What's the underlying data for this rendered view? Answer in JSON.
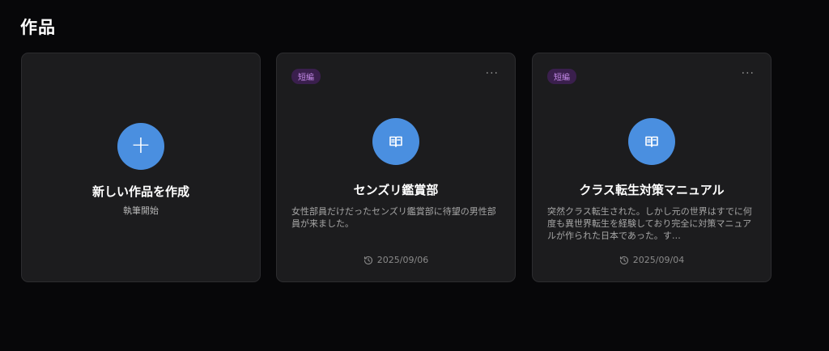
{
  "page": {
    "title": "作品"
  },
  "new_card": {
    "title": "新しい作品を作成",
    "subtitle": "執筆開始",
    "icon": "plus-icon"
  },
  "works": [
    {
      "badge": "短編",
      "title": "センズリ鑑賞部",
      "description": "女性部員だけだったセンズリ鑑賞部に待望の男性部員が来ました。",
      "date": "2025/09/06",
      "icon": "book-icon"
    },
    {
      "badge": "短編",
      "title": "クラス転生対策マニュアル",
      "description": "突然クラス転生された。しかし元の世界はすでに何度も異世界転生を経験しており完全に対策マニュアルが作られた日本であった。す…",
      "date": "2025/09/04",
      "icon": "book-icon"
    }
  ],
  "colors": {
    "accent": "#4a8fe0",
    "badge_bg": "#3a1f4d",
    "badge_text": "#c48ae8",
    "card_bg": "#1c1c1e",
    "page_bg": "#070709"
  }
}
